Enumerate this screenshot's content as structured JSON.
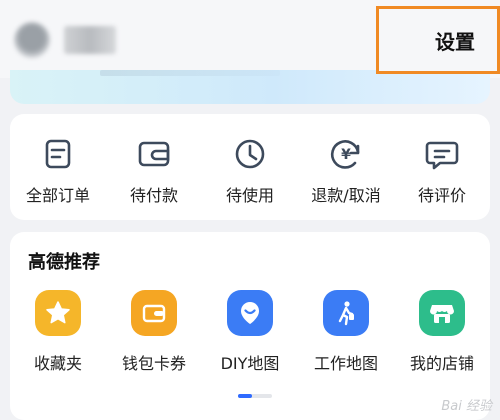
{
  "header": {
    "settings_label": "设置"
  },
  "orders": {
    "items": [
      {
        "label": "全部订单",
        "icon": "document-icon"
      },
      {
        "label": "待付款",
        "icon": "wallet-icon"
      },
      {
        "label": "待使用",
        "icon": "clock-icon"
      },
      {
        "label": "退款/取消",
        "icon": "refund-icon"
      },
      {
        "label": "待评价",
        "icon": "comment-icon"
      }
    ]
  },
  "recommend": {
    "title": "高德推荐",
    "items": [
      {
        "label": "收藏夹",
        "icon": "star-icon",
        "color": "#f5b62a"
      },
      {
        "label": "钱包卡券",
        "icon": "wallet-card-icon",
        "color": "#f5a623"
      },
      {
        "label": "DIY地图",
        "icon": "diy-map-icon",
        "color": "#3b7cf5"
      },
      {
        "label": "工作地图",
        "icon": "walker-icon",
        "color": "#3b7cf5"
      },
      {
        "label": "我的店铺",
        "icon": "store-icon",
        "color": "#2dbd8b"
      }
    ]
  },
  "colors": {
    "accent_orange": "#f08a24",
    "icon_stroke": "#3d4a5c",
    "pager_active": "#2f6bff"
  },
  "watermark": "Bai 经验"
}
